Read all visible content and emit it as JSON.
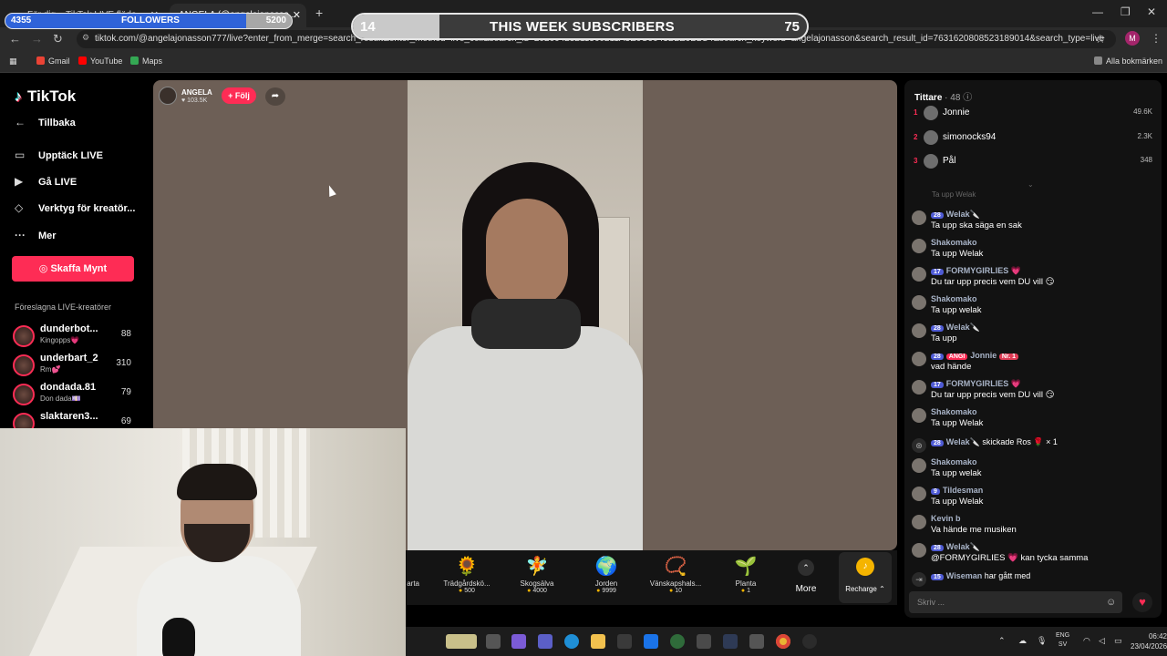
{
  "browser": {
    "tabs": [
      {
        "label": "För dig – TikTok LIVE flöde"
      },
      {
        "label": "ANGELA (@angelajonasso..."
      }
    ],
    "url": "tiktok.com/@angelajonasson777/live?enter_from_merge=search_result&enter_method=live_cell&search_id=20260423211360211A3E0C9043B2E9B2C4&search_keyword=angelajonasson&search_result_id=7631620808523189014&search_type=live",
    "profile_initial": "M",
    "bookmarks": [
      {
        "label": "Gmail",
        "color": "#ea4335"
      },
      {
        "label": "YouTube",
        "color": "#ff0000"
      },
      {
        "label": "Maps",
        "color": "#34a853"
      }
    ],
    "all_bookmarks": "Alla bokmärken"
  },
  "overlay": {
    "followers_count": "4355",
    "followers_label": "FOLLOWERS",
    "followers_goal": "5200",
    "followers_progress": 0.84,
    "subs_count": "14",
    "subs_label": "THIS WEEK SUBSCRIBERS",
    "subs_goal": "75",
    "subs_progress": 0.19
  },
  "sidebar": {
    "logo": "TikTok",
    "back": "Tillbaka",
    "nav": [
      {
        "label": "Upptäck LIVE"
      },
      {
        "label": "Gå LIVE"
      },
      {
        "label": "Verktyg för kreatör..."
      },
      {
        "label": "Mer"
      }
    ],
    "coins_button": "Skaffa Mynt",
    "suggested_title": "Föreslagna LIVE-kreatörer",
    "creators": [
      {
        "name": "dunderbot...",
        "sub": "Kingopps💗",
        "count": "88"
      },
      {
        "name": "underbart_2",
        "sub": "Rm💕",
        "count": "310"
      },
      {
        "name": "dondada.81",
        "sub": "Don dada💷",
        "count": "79"
      },
      {
        "name": "slaktaren3...",
        "sub": "",
        "count": "69"
      }
    ]
  },
  "stream": {
    "host_name": "ANGELA",
    "host_likes": "103.5K",
    "follow_label": "+ Följ"
  },
  "gifts": [
    {
      "name": "arta",
      "price": ""
    },
    {
      "name": "Trädgårdskö...",
      "price": "500",
      "icon": "🌻"
    },
    {
      "name": "Skogsälva",
      "price": "4000",
      "icon": "🧚"
    },
    {
      "name": "Jorden",
      "price": "9999",
      "icon": "🌍"
    },
    {
      "name": "Vänskapshals...",
      "price": "10",
      "icon": "📿"
    },
    {
      "name": "Planta",
      "price": "1",
      "icon": "🌱"
    }
  ],
  "gift_more": "More",
  "recharge": "Recharge",
  "chat": {
    "viewers_label": "Tittare",
    "viewers_count": "· 48",
    "top_viewers": [
      {
        "rank": "1",
        "name": "Jonnie",
        "score": "49.6K"
      },
      {
        "rank": "2",
        "name": "simonocks94",
        "score": "2.3K"
      },
      {
        "rank": "3",
        "name": "Pål",
        "score": "348"
      }
    ],
    "faded_line": "Ta upp Welak",
    "messages": [
      {
        "level": "28",
        "name": "Welak🔪",
        "text": "Ta upp ska säga en sak"
      },
      {
        "level": "",
        "name": "Shakomako",
        "text": "Ta upp Welak"
      },
      {
        "level": "17",
        "name": "FORMYGIRLIES 💗",
        "text": "Du tar upp precis vem DU vill 😏"
      },
      {
        "level": "",
        "name": "Shakomako",
        "text": "Ta upp welak"
      },
      {
        "level": "28",
        "name": "Welak🔪",
        "text": "Ta upp"
      },
      {
        "level": "28",
        "name": "Jonnie",
        "extra_badge": "ANGI",
        "rank_badge": "Nr. 1",
        "text": "vad hände"
      },
      {
        "level": "17",
        "name": "FORMYGIRLIES 💗",
        "text": "Du tar upp precis vem DU vill 😏"
      },
      {
        "level": "",
        "name": "Shakomako",
        "text": "Ta upp Welak"
      }
    ],
    "gift_event": {
      "level": "28",
      "name": "Welak🔪",
      "action": "skickade Ros 🌹 × 1"
    },
    "messages2": [
      {
        "level": "",
        "name": "Shakomako",
        "text": "Ta upp welak"
      },
      {
        "level": "9",
        "name": "Tildesman",
        "text": "Ta upp Welak"
      },
      {
        "level": "",
        "name": "Kevin b",
        "text": "Va hände me musiken"
      },
      {
        "level": "28",
        "name": "Welak🔪",
        "text": "@FORMYGIRLIES 💗 kan tycka samma"
      }
    ],
    "join_event": {
      "level": "15",
      "name": "Wiseman",
      "action": "har gått med"
    },
    "input_placeholder": "Skriv ..."
  },
  "taskbar": {
    "lang": "ENG",
    "lang2": "SV",
    "time": "06:42",
    "date": "23/04/2026"
  }
}
